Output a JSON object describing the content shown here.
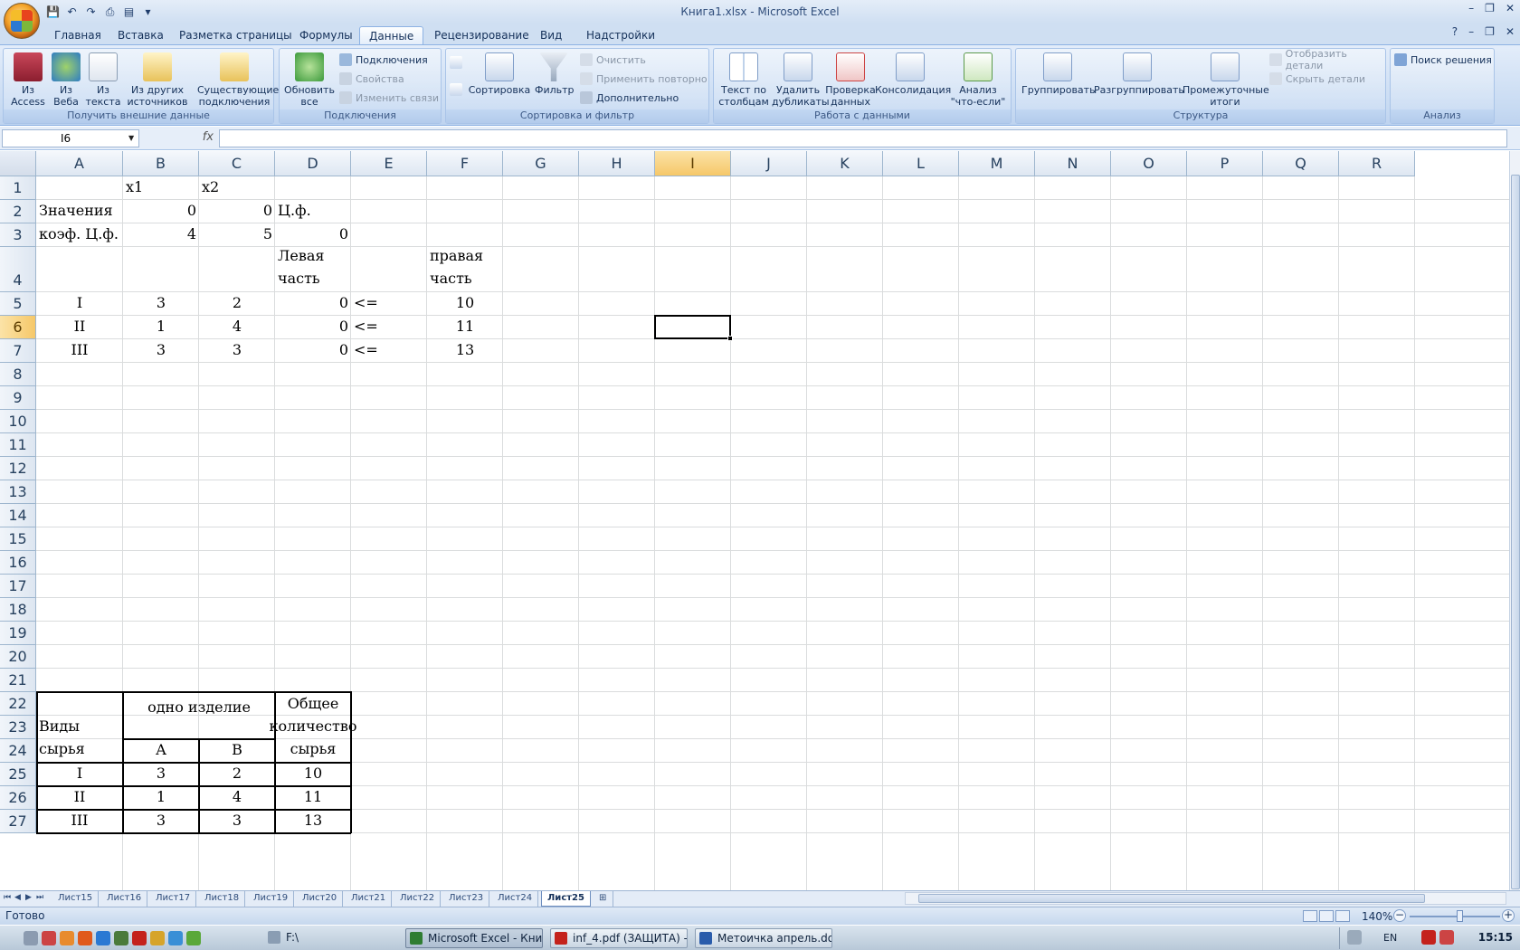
{
  "window": {
    "title": "Книга1.xlsx - Microsoft Excel"
  },
  "ribbon_tabs": [
    "Главная",
    "Вставка",
    "Разметка страницы",
    "Формулы",
    "Данные",
    "Рецензирование",
    "Вид",
    "Надстройки"
  ],
  "ribbon": {
    "ext": {
      "label": "Получить внешние данные",
      "access": "Из Access",
      "web": "Из Веба",
      "text": "Из текста",
      "other": "Из других источников",
      "existing": "Существующие подключения"
    },
    "conn": {
      "label": "Подключения",
      "refresh": "Обновить все",
      "connections": "Подключения",
      "properties": "Свойства",
      "edit_links": "Изменить связи"
    },
    "sort": {
      "label": "Сортировка и фильтр",
      "az": "А→Я",
      "za": "Я→А",
      "sort": "Сортировка",
      "filter": "Фильтр",
      "clear": "Очистить",
      "reapply": "Применить повторно",
      "advanced": "Дополнительно"
    },
    "data": {
      "label": "Работа с данными",
      "text_to_cols": "Текст по столбцам",
      "remove_dup": "Удалить дубликаты",
      "validation": "Проверка данных",
      "consolidate": "Консолидация",
      "whatif": "Анализ \"что-если\""
    },
    "outline": {
      "label": "Структура",
      "group": "Группировать",
      "ungroup": "Разгруппировать",
      "subtotal": "Промежуточные итоги",
      "show": "Отобразить детали",
      "hide": "Скрыть детали"
    },
    "analysis": {
      "label": "Анализ",
      "solver": "Поиск решения"
    }
  },
  "formula_bar": {
    "name_box": "I6",
    "fx": "fx",
    "formula": ""
  },
  "columns": [
    "A",
    "B",
    "C",
    "D",
    "E",
    "F",
    "G",
    "H",
    "I",
    "J",
    "K",
    "L",
    "M",
    "N",
    "O",
    "P",
    "Q",
    "R"
  ],
  "rows": [
    "1",
    "2",
    "3",
    "4",
    "5",
    "6",
    "7",
    "8",
    "9",
    "10",
    "11",
    "12",
    "13",
    "14",
    "15",
    "16",
    "17",
    "18",
    "19",
    "20",
    "21",
    "22",
    "23",
    "24",
    "25",
    "26",
    "27"
  ],
  "cells": {
    "B1": "x1",
    "C1": "x2",
    "A2": "Значения",
    "B2": "0",
    "C2": "0",
    "D2": "Ц.ф.",
    "A3": "коэф. Ц.ф.",
    "B3": "4",
    "C3": "5",
    "D3": "0",
    "D4": "Левая часть",
    "F4": "правая часть",
    "A5": "I",
    "B5": "3",
    "C5": "2",
    "D5": "0",
    "E5": "<=",
    "F5": "10",
    "A6": "II",
    "B6": "1",
    "C6": "4",
    "D6": "0",
    "E6": "<=",
    "F6": "11",
    "A7": "III",
    "B7": "3",
    "C7": "3",
    "D7": "0",
    "E7": "<=",
    "F7": "13",
    "A22": "Виды сырья",
    "B22": "одно изделие",
    "D22": "Общее количество сырья",
    "B24": "A",
    "C24": "B",
    "A25": "I",
    "B25": "3",
    "C25": "2",
    "D25": "10",
    "A26": "II",
    "B26": "1",
    "C26": "4",
    "D26": "11",
    "A27": "III",
    "B27": "3",
    "C27": "3",
    "D27": "13"
  },
  "sheet_tabs": [
    "Лист15",
    "Лист16",
    "Лист17",
    "Лист18",
    "Лист19",
    "Лист20",
    "Лист21",
    "Лист22",
    "Лист23",
    "Лист24",
    "Лист25"
  ],
  "active_sheet": "Лист25",
  "status": {
    "text": "Готово",
    "zoom": "140%"
  },
  "taskbar": {
    "items": [
      "F:\\",
      "Microsoft Excel - Книг...",
      "inf_4.pdf (ЗАЩИТА) -...",
      "Метоичка апрель.do..."
    ],
    "lang": "EN",
    "time": "15:15"
  }
}
